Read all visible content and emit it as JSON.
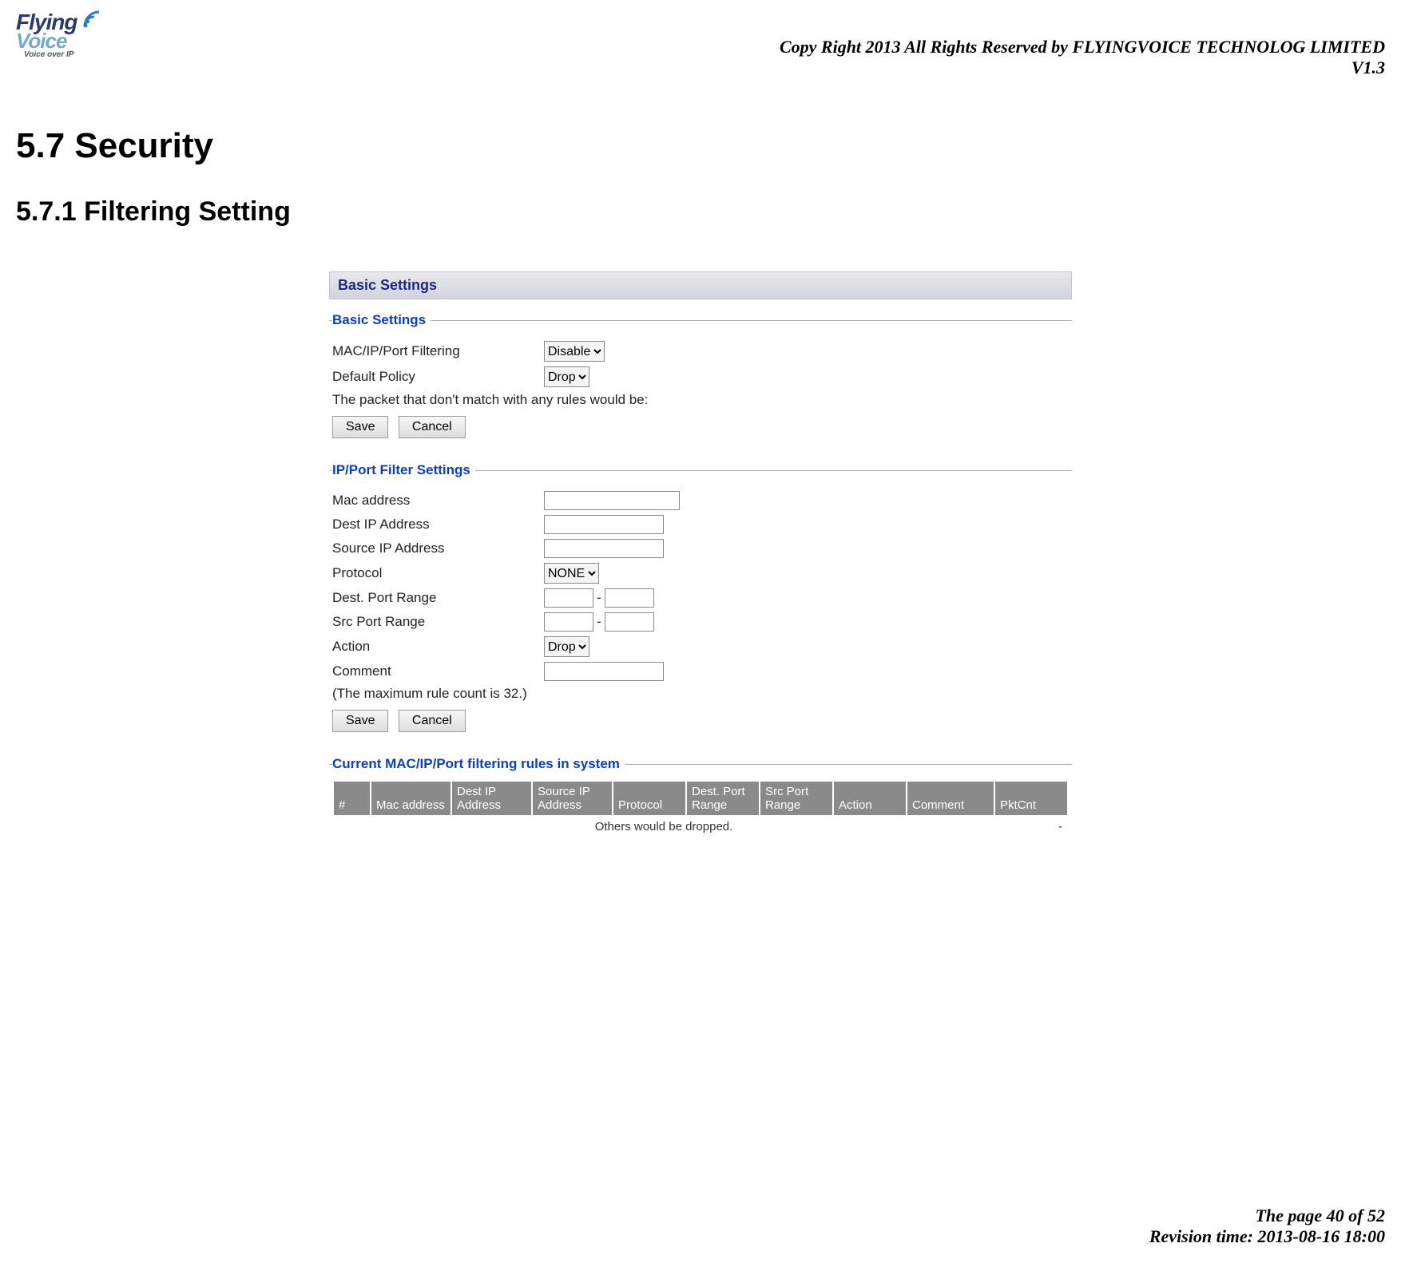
{
  "header": {
    "logo_line1": "Flying",
    "logo_line2": "Voice",
    "logo_sub": "Voice over IP",
    "copyright": "Copy Right 2013 All Rights Reserved by FLYINGVOICE TECHNOLOG LIMITED",
    "version": "V1.3"
  },
  "headings": {
    "h1": "5.7  Security",
    "h2": "5.7.1 Filtering Setting"
  },
  "panel": {
    "titlebar": "Basic Settings",
    "basic": {
      "legend": "Basic Settings",
      "filtering_label": "MAC/IP/Port Filtering",
      "filtering_value": "Disable",
      "policy_label": "Default Policy",
      "policy_value": "Drop",
      "packet_note": "The packet that don't match with any rules would be:",
      "save": "Save",
      "cancel": "Cancel"
    },
    "ipport": {
      "legend": "IP/Port Filter Settings",
      "mac_label": "Mac address",
      "destip_label": "Dest IP Address",
      "srcip_label": "Source IP Address",
      "proto_label": "Protocol",
      "proto_value": "NONE",
      "destport_label": "Dest. Port Range",
      "srcport_label": "Src Port Range",
      "action_label": "Action",
      "action_value": "Drop",
      "comment_label": "Comment",
      "max_note": "(The maximum rule count is 32.)",
      "save": "Save",
      "cancel": "Cancel",
      "range_dash": "-"
    },
    "rules": {
      "legend": "Current MAC/IP/Port filtering rules in system",
      "headers": [
        "#",
        "Mac address",
        "Dest IP Address",
        "Source IP Address",
        "Protocol",
        "Dest. Port Range",
        "Src Port Range",
        "Action",
        "Comment",
        "PktCnt"
      ],
      "note": "Others would be dropped.",
      "dash": "-"
    }
  },
  "footer": {
    "page": "The page 40 of 52",
    "revision": "Revision time: 2013-08-16 18:00"
  }
}
